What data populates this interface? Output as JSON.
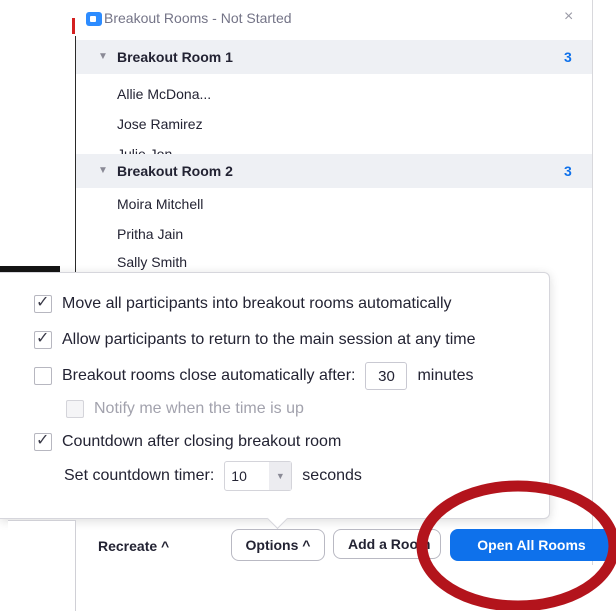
{
  "window": {
    "title": "Breakout Rooms - Not Started",
    "close_label": "×"
  },
  "rooms": [
    {
      "name": "Breakout Room 1",
      "count": "3",
      "participants": [
        "Allie McDona...",
        "Jose Ramirez",
        "Julie Jon..."
      ]
    },
    {
      "name": "Breakout Room 2",
      "count": "3",
      "participants": [
        "Moira Mitchell",
        "Pritha Jain",
        "Sally Smith"
      ]
    }
  ],
  "options": {
    "move_auto": {
      "label": "Move all participants into breakout rooms automatically",
      "checked": true
    },
    "allow_return": {
      "label": "Allow participants to return to the main session at any time",
      "checked": true
    },
    "close_auto": {
      "label": "Breakout rooms close automatically after:",
      "checked": false,
      "value": "30",
      "unit": "minutes"
    },
    "notify": {
      "label": "Notify me when the time is up",
      "checked": false,
      "disabled": true
    },
    "countdown": {
      "label": "Countdown after closing breakout room",
      "checked": true
    },
    "timer": {
      "label": "Set countdown timer:",
      "value": "10",
      "unit": "seconds"
    }
  },
  "bottombar": {
    "recreate_label": "Recreate ^",
    "options_label": "Options ^",
    "add_room_label": "Add a Room",
    "open_all_label": "Open All Rooms"
  },
  "colors": {
    "accent": "#0e71eb",
    "annotation": "#b3141c"
  }
}
